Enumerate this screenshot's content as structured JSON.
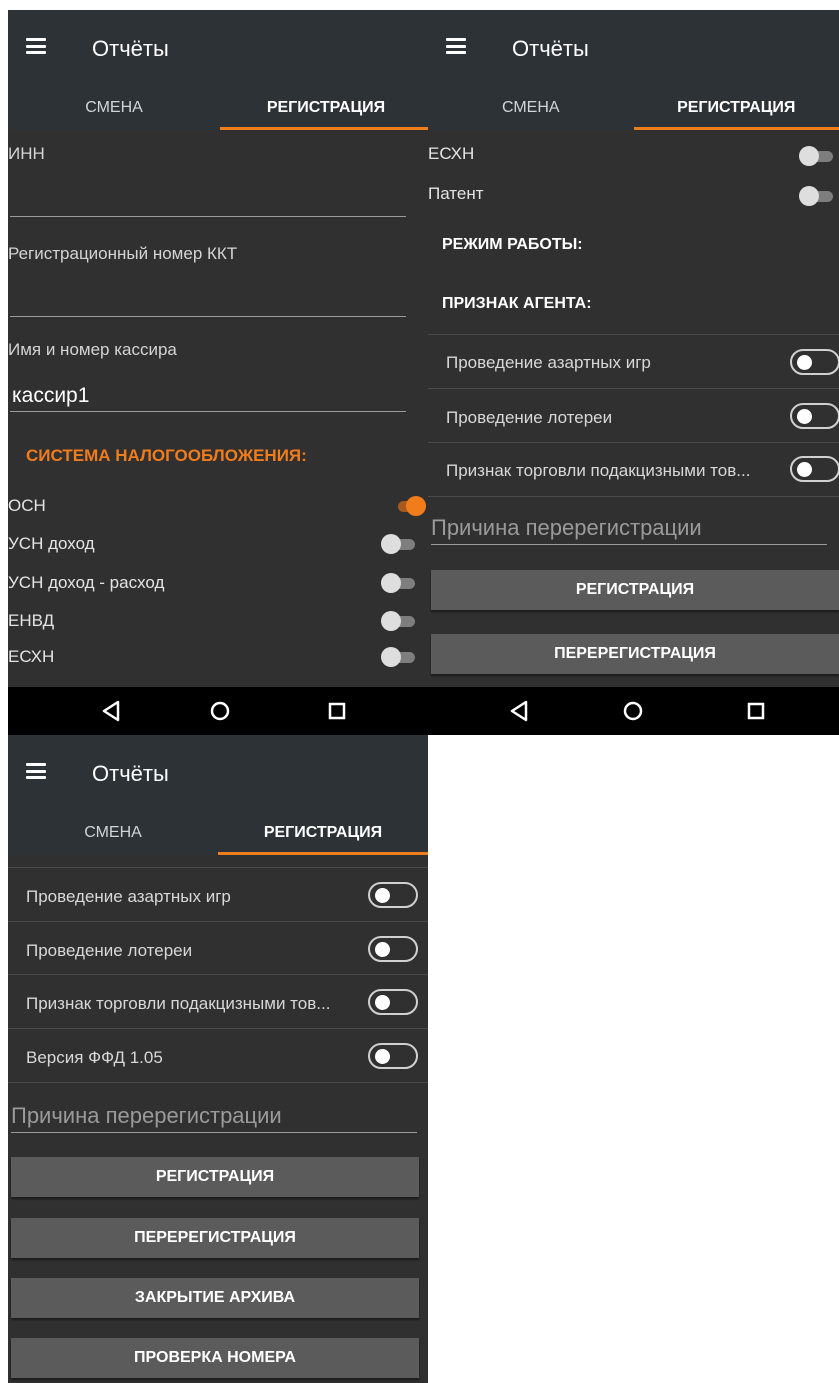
{
  "app": {
    "title": "Отчёты",
    "tabs": [
      "СМЕНА",
      "РЕГИСТРАЦИЯ"
    ],
    "accent": "#f07c1c",
    "appbar_color": "#2c3235",
    "background_color": "#303030"
  },
  "screen1": {
    "fields": [
      {
        "label": "ИНН",
        "value": ""
      },
      {
        "label": "Регистрационный номер ККТ",
        "value": ""
      },
      {
        "label": "Имя и номер кассира",
        "value": "кассир1"
      }
    ],
    "tax_section_title": "СИСТЕМА НАЛОГООБЛОЖЕНИЯ:",
    "tax_options": [
      {
        "label": "ОСН",
        "on": true
      },
      {
        "label": "УСН доход",
        "on": false
      },
      {
        "label": "УСН доход - расход",
        "on": false
      },
      {
        "label": "ЕНВД",
        "on": false
      },
      {
        "label": "ЕСХН",
        "on": false
      }
    ]
  },
  "screen2": {
    "tax_options": [
      {
        "label": "ЕСХН",
        "on": false
      },
      {
        "label": "Патент",
        "on": false
      }
    ],
    "mode_title": "РЕЖИМ РАБОТЫ:",
    "agent_title": "ПРИЗНАК АГЕНТА:",
    "mode_options": [
      {
        "label": "Проведение азартных игр",
        "on": false
      },
      {
        "label": "Проведение лотереи",
        "on": false
      },
      {
        "label": "Признак торговли подакцизными тов...",
        "on": false
      }
    ],
    "reason_placeholder": "Причина перерегистрации",
    "buttons": [
      "РЕГИСТРАЦИЯ",
      "ПЕРЕРЕГИСТРАЦИЯ"
    ]
  },
  "screen3": {
    "mode_options": [
      {
        "label": "Проведение азартных игр",
        "on": false
      },
      {
        "label": "Проведение лотереи",
        "on": false
      },
      {
        "label": "Признак торговли подакцизными тов...",
        "on": false
      },
      {
        "label": "Версия ФФД 1.05",
        "on": false
      }
    ],
    "reason_placeholder": "Причина перерегистрации",
    "buttons": [
      "РЕГИСТРАЦИЯ",
      "ПЕРЕРЕГИСТРАЦИЯ",
      "ЗАКРЫТИЕ АРХИВА",
      "ПРОВЕРКА НОМЕРА"
    ]
  },
  "navbar": {
    "icons": [
      "back-icon",
      "home-icon",
      "recent-apps-icon"
    ]
  }
}
